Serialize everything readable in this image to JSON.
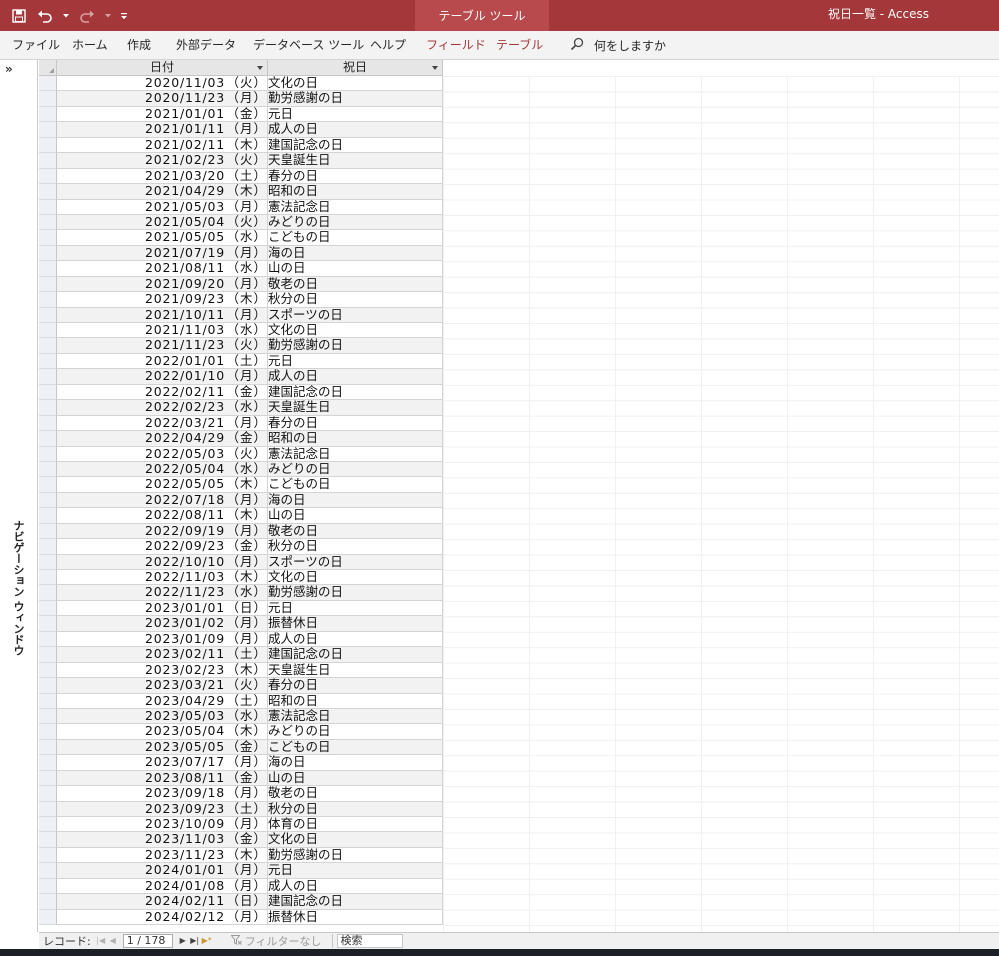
{
  "titlebar": {
    "context_tab": "テーブル ツール",
    "window_title": "祝日一覧  -  Access",
    "accent": "#a4373a"
  },
  "ribbon": {
    "tabs": [
      "ファイル",
      "ホーム",
      "作成",
      "外部データ",
      "データベース ツール",
      "ヘルプ"
    ],
    "context_tabs": [
      "フィールド",
      "テーブル"
    ],
    "tell_me": "何をしますか"
  },
  "nav_pane": {
    "label": "ナビゲーション ウィンドウ",
    "expand_glyph": "»"
  },
  "table": {
    "columns": [
      "日付",
      "祝日"
    ],
    "rows": [
      [
        "2020/11/03",
        "（火）",
        "文化の日"
      ],
      [
        "2020/11/23",
        "（月）",
        "勤労感謝の日"
      ],
      [
        "2021/01/01",
        "（金）",
        "元日"
      ],
      [
        "2021/01/11",
        "（月）",
        "成人の日"
      ],
      [
        "2021/02/11",
        "（木）",
        "建国記念の日"
      ],
      [
        "2021/02/23",
        "（火）",
        "天皇誕生日"
      ],
      [
        "2021/03/20",
        "（土）",
        "春分の日"
      ],
      [
        "2021/04/29",
        "（木）",
        "昭和の日"
      ],
      [
        "2021/05/03",
        "（月）",
        "憲法記念日"
      ],
      [
        "2021/05/04",
        "（火）",
        "みどりの日"
      ],
      [
        "2021/05/05",
        "（水）",
        "こどもの日"
      ],
      [
        "2021/07/19",
        "（月）",
        "海の日"
      ],
      [
        "2021/08/11",
        "（水）",
        "山の日"
      ],
      [
        "2021/09/20",
        "（月）",
        "敬老の日"
      ],
      [
        "2021/09/23",
        "（木）",
        "秋分の日"
      ],
      [
        "2021/10/11",
        "（月）",
        "スポーツの日"
      ],
      [
        "2021/11/03",
        "（水）",
        "文化の日"
      ],
      [
        "2021/11/23",
        "（火）",
        "勤労感謝の日"
      ],
      [
        "2022/01/01",
        "（土）",
        "元日"
      ],
      [
        "2022/01/10",
        "（月）",
        "成人の日"
      ],
      [
        "2022/02/11",
        "（金）",
        "建国記念の日"
      ],
      [
        "2022/02/23",
        "（水）",
        "天皇誕生日"
      ],
      [
        "2022/03/21",
        "（月）",
        "春分の日"
      ],
      [
        "2022/04/29",
        "（金）",
        "昭和の日"
      ],
      [
        "2022/05/03",
        "（火）",
        "憲法記念日"
      ],
      [
        "2022/05/04",
        "（水）",
        "みどりの日"
      ],
      [
        "2022/05/05",
        "（木）",
        "こどもの日"
      ],
      [
        "2022/07/18",
        "（月）",
        "海の日"
      ],
      [
        "2022/08/11",
        "（木）",
        "山の日"
      ],
      [
        "2022/09/19",
        "（月）",
        "敬老の日"
      ],
      [
        "2022/09/23",
        "（金）",
        "秋分の日"
      ],
      [
        "2022/10/10",
        "（月）",
        "スポーツの日"
      ],
      [
        "2022/11/03",
        "（木）",
        "文化の日"
      ],
      [
        "2022/11/23",
        "（水）",
        "勤労感謝の日"
      ],
      [
        "2023/01/01",
        "（日）",
        "元日"
      ],
      [
        "2023/01/02",
        "（月）",
        "振替休日"
      ],
      [
        "2023/01/09",
        "（月）",
        "成人の日"
      ],
      [
        "2023/02/11",
        "（土）",
        "建国記念の日"
      ],
      [
        "2023/02/23",
        "（木）",
        "天皇誕生日"
      ],
      [
        "2023/03/21",
        "（火）",
        "春分の日"
      ],
      [
        "2023/04/29",
        "（土）",
        "昭和の日"
      ],
      [
        "2023/05/03",
        "（水）",
        "憲法記念日"
      ],
      [
        "2023/05/04",
        "（木）",
        "みどりの日"
      ],
      [
        "2023/05/05",
        "（金）",
        "こどもの日"
      ],
      [
        "2023/07/17",
        "（月）",
        "海の日"
      ],
      [
        "2023/08/11",
        "（金）",
        "山の日"
      ],
      [
        "2023/09/18",
        "（月）",
        "敬老の日"
      ],
      [
        "2023/09/23",
        "（土）",
        "秋分の日"
      ],
      [
        "2023/10/09",
        "（月）",
        "体育の日"
      ],
      [
        "2023/11/03",
        "（金）",
        "文化の日"
      ],
      [
        "2023/11/23",
        "（木）",
        "勤労感謝の日"
      ],
      [
        "2024/01/01",
        "（月）",
        "元日"
      ],
      [
        "2024/01/08",
        "（月）",
        "成人の日"
      ],
      [
        "2024/02/11",
        "（日）",
        "建国記念の日"
      ],
      [
        "2024/02/12",
        "（月）",
        "振替休日"
      ]
    ]
  },
  "record_bar": {
    "label": "レコード:",
    "position": "1 / 178",
    "filter": "フィルターなし",
    "search": "検索"
  }
}
